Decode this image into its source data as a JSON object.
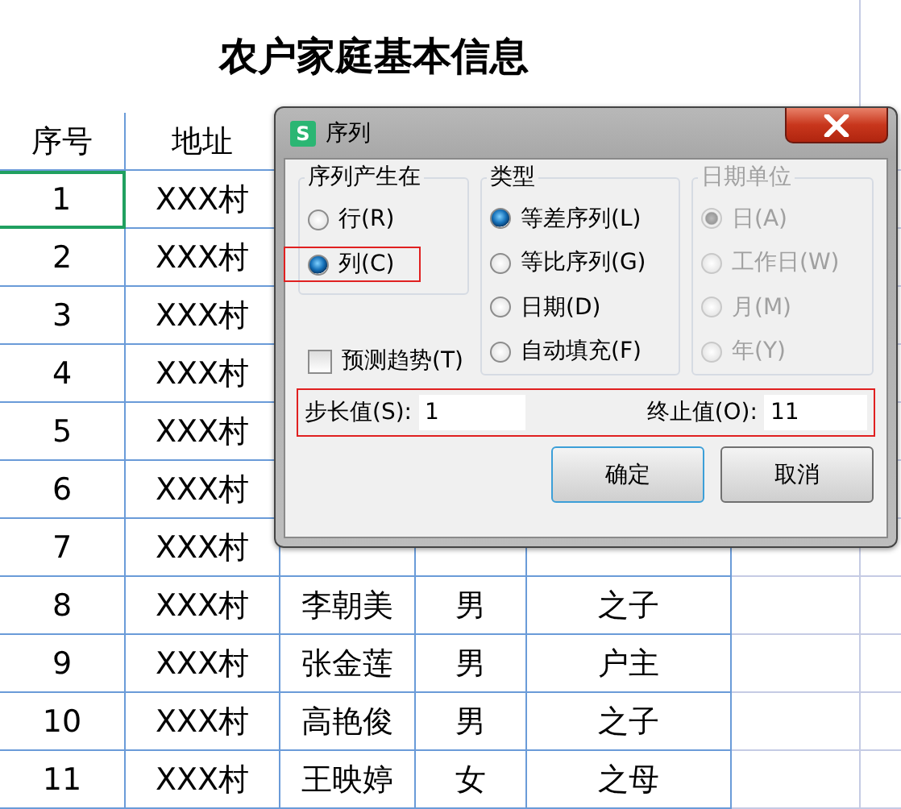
{
  "sheet": {
    "title": "农户家庭基本信息",
    "columns": [
      "序号",
      "地址"
    ],
    "rows": [
      {
        "cells": [
          "1",
          "XXX村"
        ],
        "selected": true
      },
      {
        "cells": [
          "2",
          "XXX村"
        ],
        "selected": false
      },
      {
        "cells": [
          "3",
          "XXX村"
        ],
        "selected": false
      },
      {
        "cells": [
          "4",
          "XXX村"
        ],
        "selected": false
      },
      {
        "cells": [
          "5",
          "XXX村"
        ],
        "selected": false
      },
      {
        "cells": [
          "6",
          "XXX村"
        ],
        "selected": false
      },
      {
        "cells": [
          "7",
          "XXX村"
        ],
        "selected": false
      },
      {
        "cells": [
          "8",
          "XXX村",
          "李朝美",
          "男",
          "之子"
        ],
        "selected": false
      },
      {
        "cells": [
          "9",
          "XXX村",
          "张金莲",
          "男",
          "户主"
        ],
        "selected": false
      },
      {
        "cells": [
          "10",
          "XXX村",
          "高艳俊",
          "男",
          "之子"
        ],
        "selected": false
      },
      {
        "cells": [
          "11",
          "XXX村",
          "王映婷",
          "女",
          "之母"
        ],
        "selected": false
      }
    ]
  },
  "dialog": {
    "icon_label": "S",
    "title": "序列",
    "groups": [
      {
        "title": "序列产生在",
        "disabled": false,
        "options": [
          {
            "label": "行(R)",
            "selected": false,
            "highlighted": false
          },
          {
            "label": "列(C)",
            "selected": true,
            "highlighted": true
          }
        ]
      },
      {
        "title": "类型",
        "disabled": false,
        "options": [
          {
            "label": "等差序列(L)",
            "selected": true,
            "highlighted": false
          },
          {
            "label": "等比序列(G)",
            "selected": false,
            "highlighted": false
          },
          {
            "label": "日期(D)",
            "selected": false,
            "highlighted": false
          },
          {
            "label": "自动填充(F)",
            "selected": false,
            "highlighted": false
          }
        ]
      },
      {
        "title": "日期单位",
        "disabled": true,
        "options": [
          {
            "label": "日(A)",
            "selected": true,
            "highlighted": false
          },
          {
            "label": "工作日(W)",
            "selected": false,
            "highlighted": false
          },
          {
            "label": "月(M)",
            "selected": false,
            "highlighted": false
          },
          {
            "label": "年(Y)",
            "selected": false,
            "highlighted": false
          }
        ]
      }
    ],
    "trend": {
      "label": "预测趋势(T)",
      "checked": false
    },
    "values_highlighted": true,
    "step": {
      "label": "步长值(S):",
      "value": "1"
    },
    "stop": {
      "label": "终止值(O):",
      "value": "11"
    },
    "buttons": [
      {
        "label": "确定",
        "default": true
      },
      {
        "label": "取消",
        "default": false
      }
    ]
  }
}
